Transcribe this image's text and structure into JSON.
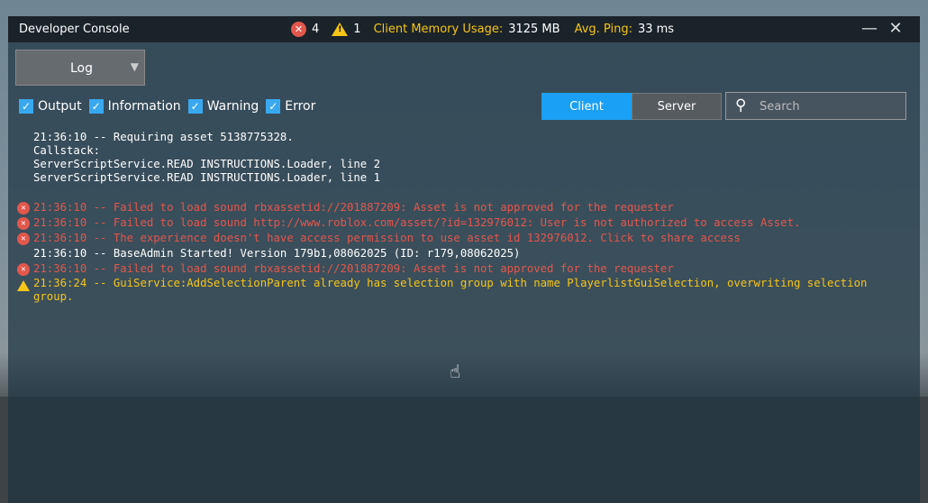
{
  "window": {
    "title": "Developer Console",
    "minimize": "—",
    "close": "✕"
  },
  "stats": {
    "errors": "4",
    "warnings": "1",
    "memory_label": "Client Memory Usage:",
    "memory_value": "3125 MB",
    "ping_label": "Avg. Ping:",
    "ping_value": "33 ms"
  },
  "dropdown": {
    "selected": "Log"
  },
  "filters": [
    {
      "label": "Output",
      "checked": true
    },
    {
      "label": "Information",
      "checked": true
    },
    {
      "label": "Warning",
      "checked": true
    },
    {
      "label": "Error",
      "checked": true
    }
  ],
  "tabs": [
    {
      "label": "Client",
      "active": true
    },
    {
      "label": "Server",
      "active": false
    }
  ],
  "search": {
    "placeholder": "Search"
  },
  "log": {
    "info_block": [
      "21:36:10 -- Requiring asset 5138775328.",
      "Callstack:",
      "ServerScriptService.READ INSTRUCTIONS.Loader, line 2",
      "ServerScriptService.READ INSTRUCTIONS.Loader, line 1"
    ],
    "entries": [
      {
        "type": "error",
        "text": "21:36:10 -- Failed to load sound rbxassetid://201887209: Asset is not approved for the requester"
      },
      {
        "type": "error",
        "text": "21:36:10 -- Failed to load sound http://www.roblox.com/asset/?id=132976012: User is not authorized to access Asset."
      },
      {
        "type": "error",
        "text": "21:36:10 -- The experience doesn't have access permission to use asset id 132976012. Click to share access"
      },
      {
        "type": "output",
        "text": "21:36:10 -- BaseAdmin Started! Version 179b1,08062025 (ID: r179,08062025)"
      },
      {
        "type": "error",
        "text": "21:36:10 -- Failed to load sound rbxassetid://201887209: Asset is not approved for the requester"
      },
      {
        "type": "warning",
        "text": "21:36:24 -- GuiService:AddSelectionParent already has selection group with name PlayerlistGuiSelection, overwriting selection group."
      }
    ]
  }
}
